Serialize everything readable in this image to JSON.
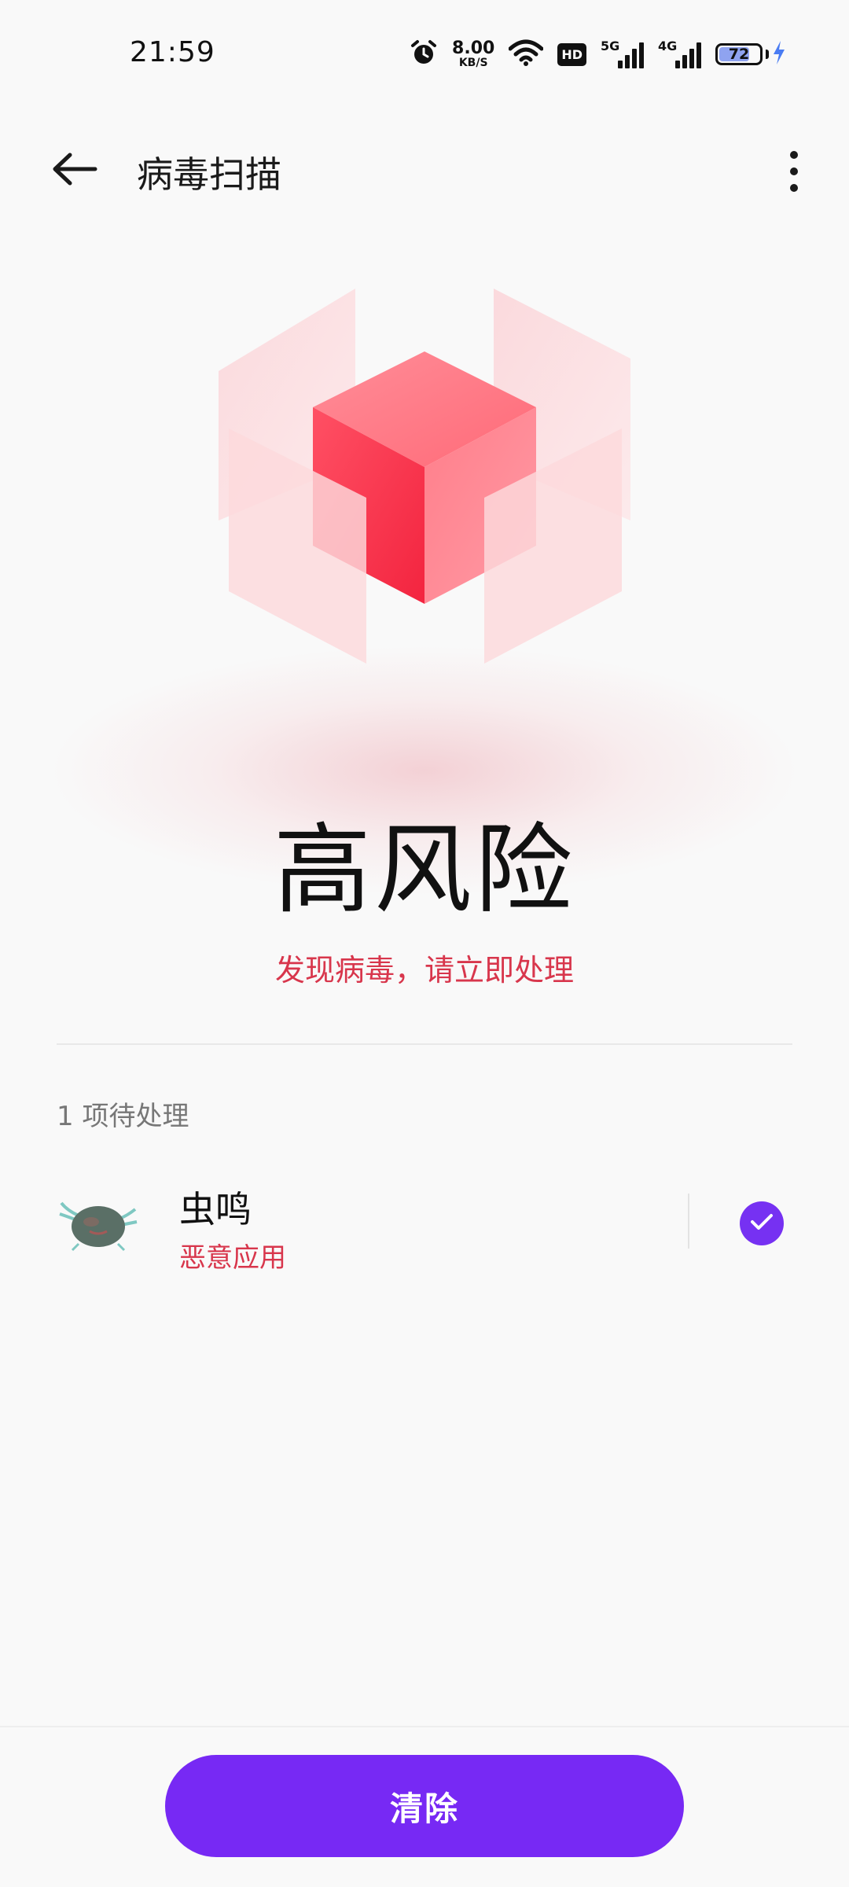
{
  "status_bar": {
    "time": "21:59",
    "net_speed_value": "8.00",
    "net_speed_unit": "KB/S",
    "hd_label": "HD",
    "sim1_tag": "5G",
    "sim2_tag": "4G",
    "battery_level": "72",
    "icons": [
      "alarm-icon",
      "wifi-icon",
      "hd-icon",
      "signal-5g-icon",
      "signal-4g-icon",
      "battery-icon",
      "charging-icon"
    ]
  },
  "header": {
    "title": "病毒扫描",
    "back_icon": "arrow-left-icon",
    "more_icon": "more-vertical-icon"
  },
  "risk": {
    "level": "高风险",
    "message": "发现病毒，请立即处理"
  },
  "pending": {
    "label": "1 项待处理",
    "items": [
      {
        "name": "虫鸣",
        "tag": "恶意应用",
        "checked": true
      }
    ]
  },
  "actions": {
    "clear_label": "清除"
  },
  "colors": {
    "accent": "#7729f4",
    "danger": "#d8364c",
    "background": "#f9f9f9"
  }
}
